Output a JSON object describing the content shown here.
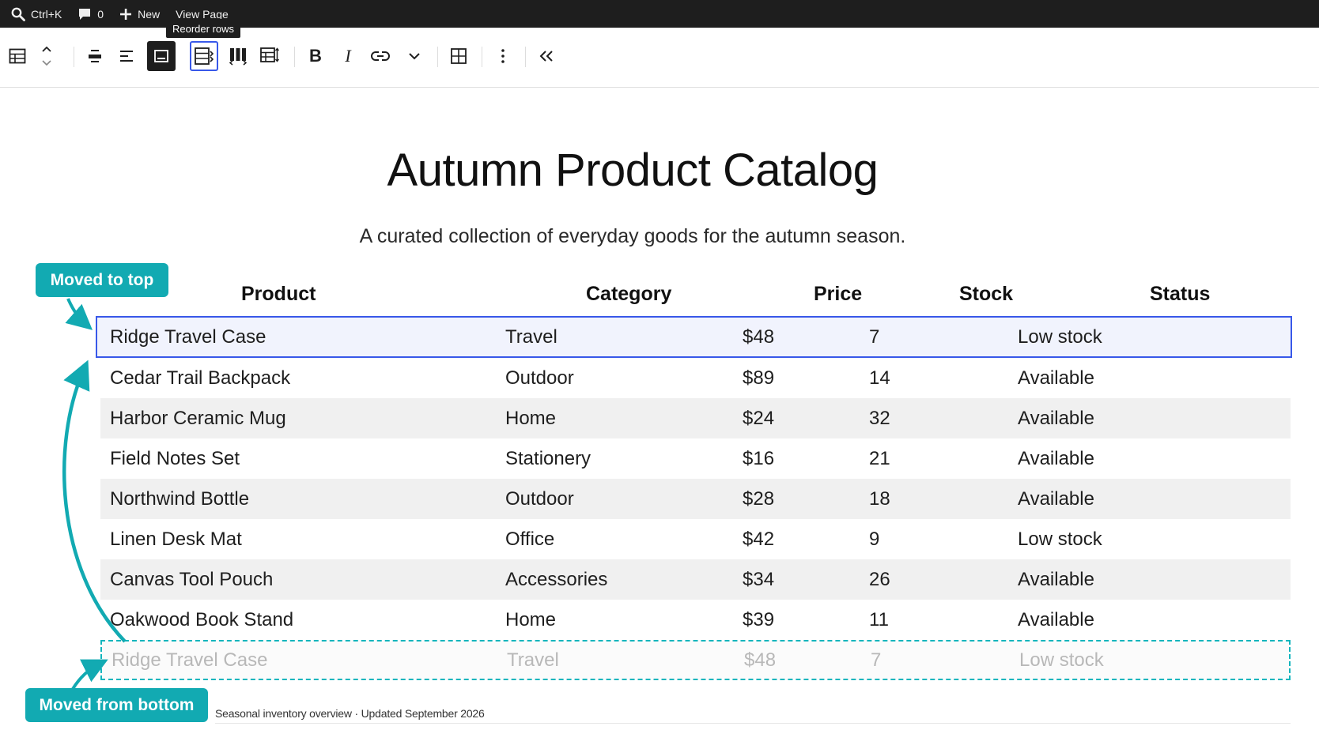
{
  "admin_bar": {
    "search_label": "Ctrl+K",
    "comments_count": "0",
    "new_label": "New",
    "view_page_label": "View Page"
  },
  "tooltip": {
    "text": "Reorder rows"
  },
  "toolbar": {
    "bold_label": "B",
    "italic_label": "I"
  },
  "document": {
    "title": "Autumn Product Catalog",
    "subtitle": "A curated collection of everyday goods for the autumn season.",
    "caption": "Seasonal inventory overview · Updated September 2026"
  },
  "table": {
    "headers": [
      "Product",
      "Category",
      "Price",
      "Stock",
      "Status"
    ],
    "rows": [
      [
        "Ridge Travel Case",
        "Travel",
        "$48",
        "7",
        "Low stock"
      ],
      [
        "Cedar Trail Backpack",
        "Outdoor",
        "$89",
        "14",
        "Available"
      ],
      [
        "Harbor Ceramic Mug",
        "Home",
        "$24",
        "32",
        "Available"
      ],
      [
        "Field Notes Set",
        "Stationery",
        "$16",
        "21",
        "Available"
      ],
      [
        "Northwind Bottle",
        "Outdoor",
        "$28",
        "18",
        "Available"
      ],
      [
        "Linen Desk Mat",
        "Office",
        "$42",
        "9",
        "Low stock"
      ],
      [
        "Canvas Tool Pouch",
        "Accessories",
        "$34",
        "26",
        "Available"
      ],
      [
        "Oakwood Book Stand",
        "Home",
        "$39",
        "11",
        "Available"
      ]
    ],
    "ghost_row": [
      "Ridge Travel Case",
      "Travel",
      "$48",
      "7",
      "Low stock"
    ]
  },
  "annotations": {
    "moved_to_top": "Moved to top",
    "moved_from_bottom": "Moved from bottom"
  },
  "colors": {
    "accent_blue": "#3858e9",
    "annotation_teal": "#12aab2",
    "admin_bar": "#1e1e1e"
  }
}
